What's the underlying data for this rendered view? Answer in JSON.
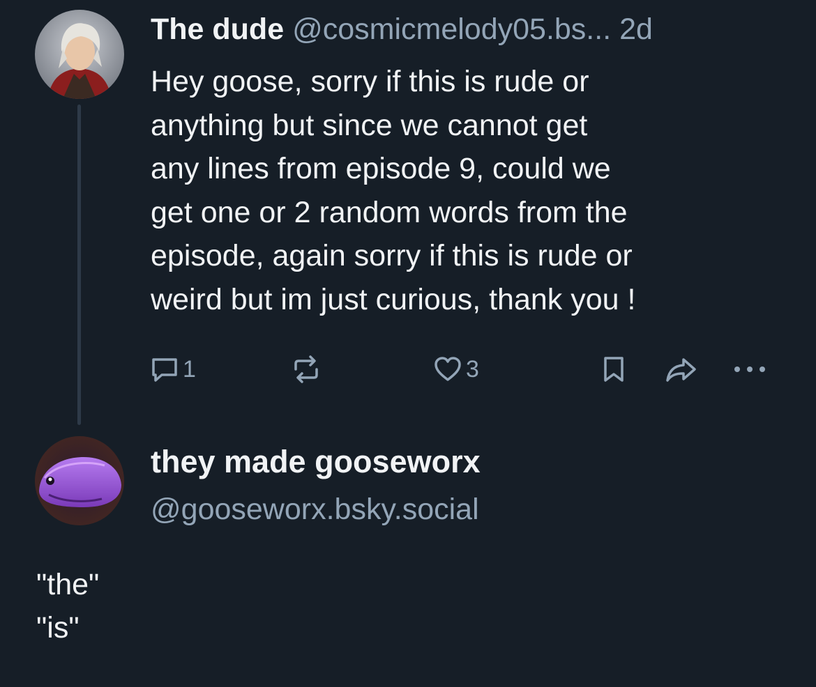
{
  "parent_post": {
    "display_name": "The dude",
    "handle": "@cosmicmelody05.bs...",
    "time": "2d",
    "text_lines": [
      "Hey goose, sorry if this is rude or",
      "anything but since we cannot get",
      "any lines from episode 9, could we",
      "get one or 2 random words from the",
      "episode, again sorry if this is rude or",
      "weird but im just curious, thank you !"
    ],
    "reply_count": "1",
    "like_count": "3",
    "avatar_icon": "user-avatar"
  },
  "reply_post": {
    "display_name": "they made gooseworx",
    "handle": "@gooseworx.bsky.social",
    "text_lines": [
      "\"the\"",
      "\"is\""
    ],
    "avatar_icon": "user-avatar"
  },
  "icons": {
    "reply": "speech-bubble-icon",
    "repost": "repost-arrows-icon",
    "like": "heart-icon",
    "bookmark": "bookmark-icon",
    "share": "share-arrow-icon",
    "more": "ellipsis-icon"
  },
  "colors": {
    "background": "#161e27",
    "text": "#f1f3f5",
    "secondary_text": "#93a5b7",
    "thread_line": "#2e3a48"
  }
}
